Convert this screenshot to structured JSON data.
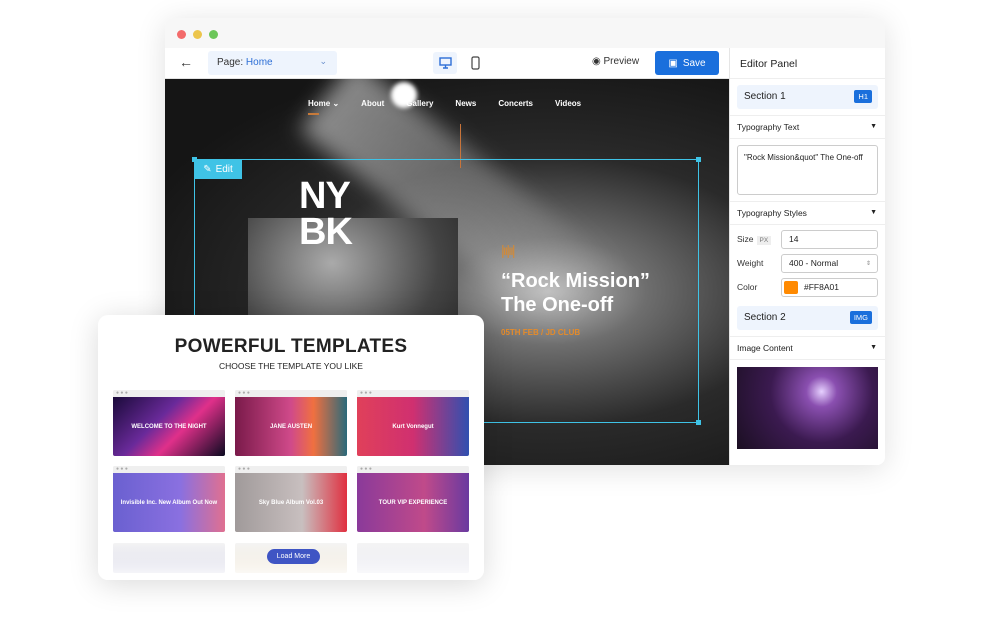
{
  "window": {
    "controls": [
      "close",
      "minimize",
      "maximize"
    ]
  },
  "toolbar": {
    "page_label": "Page:",
    "page_value": "Home",
    "preview": "Preview",
    "save": "Save"
  },
  "site": {
    "nav": [
      "Home",
      "About",
      "Gallery",
      "News",
      "Concerts",
      "Videos"
    ],
    "logo": "NY\nBK",
    "edit": "Edit",
    "headline_1": "“Rock Mission”",
    "headline_2": "The One-off",
    "date": "05TH FEB / JD CLUB"
  },
  "panel": {
    "title": "Editor Panel",
    "section1": {
      "label": "Section 1",
      "badge": "H1"
    },
    "typography_text": "Typography Text",
    "text_value": "\"Rock Mission&quot\" The One-off",
    "typography_styles": "Typography Styles",
    "size_label": "Size",
    "size_unit": "PX",
    "size_value": "14",
    "weight_label": "Weight",
    "weight_value": "400 - Normal",
    "color_label": "Color",
    "color_value": "#FF8A01",
    "section2": {
      "label": "Section 2",
      "badge": "IMG"
    },
    "image_content": "Image Content"
  },
  "templates": {
    "title": "POWERFUL TEMPLATES",
    "subtitle": "CHOOSE THE TEMPLATE YOU LIKE",
    "load_more": "Load More",
    "items": [
      {
        "label": "WELCOME TO THE NIGHT"
      },
      {
        "label": "JANE AUSTEN"
      },
      {
        "label": "Kurt Vonnegut"
      },
      {
        "label": "Invisible Inc. New Album Out Now"
      },
      {
        "label": "Sky Blue Album Vol.03"
      },
      {
        "label": "TOUR VIP EXPERIENCE"
      }
    ]
  },
  "colors": {
    "accent": "#1a6fdc",
    "selection": "#3fc3e6",
    "highlight": "#FF8A01"
  }
}
